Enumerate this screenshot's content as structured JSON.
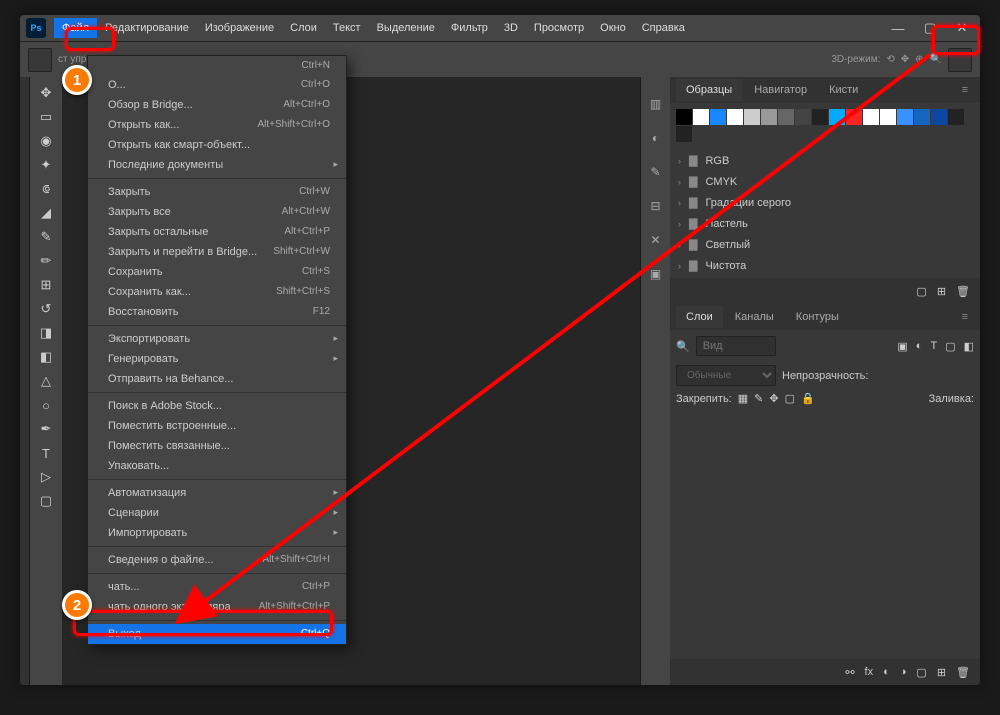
{
  "menubar": {
    "items": [
      "Файл",
      "Редактирование",
      "Изображение",
      "Слои",
      "Текст",
      "Выделение",
      "Фильтр",
      "3D",
      "Просмотр",
      "Окно",
      "Справка"
    ],
    "active": 0
  },
  "options_bar": {
    "label": "ст упр. элем.",
    "mode_label": "3D-режим:"
  },
  "dropdown": {
    "groups": [
      [
        {
          "label": "",
          "shortcut": "Ctrl+N"
        },
        {
          "label": "О...",
          "shortcut": "Ctrl+O"
        },
        {
          "label": "Обзор в Bridge...",
          "shortcut": "Alt+Ctrl+O"
        },
        {
          "label": "Открыть как...",
          "shortcut": "Alt+Shift+Ctrl+O"
        },
        {
          "label": "Открыть как смарт-объект...",
          "shortcut": ""
        },
        {
          "label": "Последние документы",
          "shortcut": "",
          "sub": true
        }
      ],
      [
        {
          "label": "Закрыть",
          "shortcut": "Ctrl+W"
        },
        {
          "label": "Закрыть все",
          "shortcut": "Alt+Ctrl+W"
        },
        {
          "label": "Закрыть остальные",
          "shortcut": "Alt+Ctrl+P"
        },
        {
          "label": "Закрыть и перейти в Bridge...",
          "shortcut": "Shift+Ctrl+W"
        },
        {
          "label": "Сохранить",
          "shortcut": "Ctrl+S"
        },
        {
          "label": "Сохранить как...",
          "shortcut": "Shift+Ctrl+S"
        },
        {
          "label": "Восстановить",
          "shortcut": "F12"
        }
      ],
      [
        {
          "label": "Экспортировать",
          "shortcut": "",
          "sub": true
        },
        {
          "label": "Генерировать",
          "shortcut": "",
          "sub": true
        },
        {
          "label": "Отправить на Behance...",
          "shortcut": ""
        }
      ],
      [
        {
          "label": "Поиск в Adobe Stock...",
          "shortcut": ""
        },
        {
          "label": "Поместить встроенные...",
          "shortcut": ""
        },
        {
          "label": "Поместить связанные...",
          "shortcut": ""
        },
        {
          "label": "Упаковать...",
          "shortcut": ""
        }
      ],
      [
        {
          "label": "Автоматизация",
          "shortcut": "",
          "sub": true
        },
        {
          "label": "Сценарии",
          "shortcut": "",
          "sub": true
        },
        {
          "label": "Импортировать",
          "shortcut": "",
          "sub": true
        }
      ],
      [
        {
          "label": "Сведения о файле...",
          "shortcut": "Alt+Shift+Ctrl+I"
        }
      ],
      [
        {
          "label": "чать...",
          "shortcut": "Ctrl+P"
        },
        {
          "label": "чать одного экземпляра",
          "shortcut": "Alt+Shift+Ctrl+P"
        }
      ],
      [
        {
          "label": "Выход",
          "shortcut": "Ctrl+Q",
          "selected": true
        }
      ]
    ]
  },
  "panels": {
    "swatches": {
      "tabs": [
        "Образцы",
        "Навигатор",
        "Кисти"
      ],
      "active": 0,
      "colors": [
        "#000",
        "#fff",
        "#1a86ff",
        "#fff",
        "#ccc",
        "#999",
        "#666",
        "#444",
        "#222",
        "#0af",
        "#f22",
        "#fff",
        "#fff",
        "#3a90ff",
        "#1565c0",
        "#0d47a1",
        "#222",
        "#222"
      ],
      "groups": [
        "RGB",
        "CMYK",
        "Градации серого",
        "Пастель",
        "Светлый",
        "Чистота"
      ]
    },
    "layers": {
      "tabs": [
        "Слои",
        "Каналы",
        "Контуры"
      ],
      "active": 0,
      "search_placeholder": "Вид",
      "blend_placeholder": "Обычные",
      "opacity_label": "Непрозрачность:",
      "lock_label": "Закрепить:",
      "fill_label": "Заливка:"
    }
  },
  "markers": {
    "one": "1",
    "two": "2"
  }
}
